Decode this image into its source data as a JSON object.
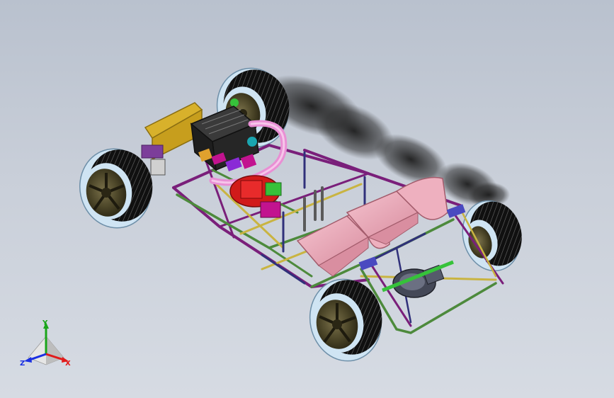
{
  "viewport": {
    "background_top": "#b9c1ce",
    "background_bottom": "#d6dbe3"
  },
  "model": {
    "colors": {
      "tire": "#0f0f0f",
      "tire_sidewall": "#b9d8ee",
      "rim": "#4a4427",
      "frame_purple": "#7a1f7a",
      "frame_green": "#4d8a3c",
      "frame_yellow": "#c9b441",
      "frame_navy": "#30307a",
      "seat": "#e9a4b4",
      "engine_block": "#2a2a2a",
      "intake_pipe": "#e98fd4",
      "radiator": "#d8b12b",
      "differential": "#444857",
      "red_part": "#d11a1a",
      "magenta_part": "#c2138f",
      "shadow": "#202020"
    }
  },
  "triad": {
    "x_label": "X",
    "y_label": "Y",
    "z_label": "Z",
    "x_color": "#e21a1a",
    "y_color": "#1aa51a",
    "z_color": "#1a2fe2"
  }
}
